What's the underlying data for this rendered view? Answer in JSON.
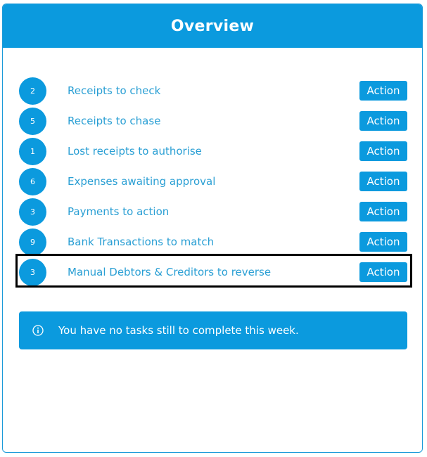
{
  "panel": {
    "title": "Overview"
  },
  "tasks": [
    {
      "count": "2",
      "label": "Receipts to check",
      "action": "Action"
    },
    {
      "count": "5",
      "label": "Receipts to chase",
      "action": "Action"
    },
    {
      "count": "1",
      "label": "Lost receipts to authorise",
      "action": "Action"
    },
    {
      "count": "6",
      "label": "Expenses awaiting approval",
      "action": "Action"
    },
    {
      "count": "3",
      "label": "Payments to action",
      "action": "Action"
    },
    {
      "count": "9",
      "label": "Bank Transactions to match",
      "action": "Action"
    },
    {
      "count": "3",
      "label": "Manual Debtors & Creditors to reverse",
      "action": "Action"
    }
  ],
  "notice": {
    "icon": "info-icon",
    "text": "You have no tasks still to complete this week."
  },
  "colors": {
    "brand": "#0b9ade",
    "label_text": "#2a9fd4",
    "highlight_border": "#000000"
  }
}
